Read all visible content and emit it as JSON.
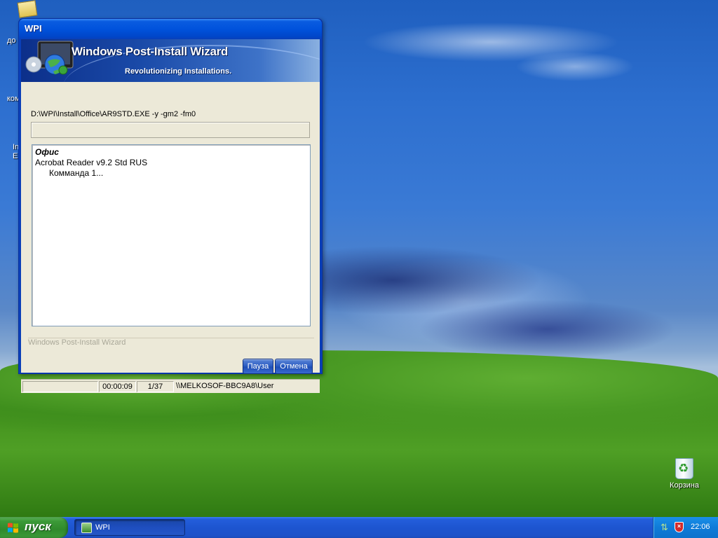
{
  "desktop": {
    "left_icon_labels": [
      "до",
      "ком",
      "In",
      "E"
    ],
    "recycle_bin_label": "Корзина"
  },
  "window": {
    "title": "WPI",
    "banner_title": "Windows Post-Install Wizard",
    "banner_subtitle": "Revolutionizing Installations.",
    "command_line": "D:\\WPI\\Install\\Office\\AR9STD.EXE -y -gm2 -fm0",
    "progress_fraction": 0,
    "log": {
      "category": "Офис",
      "program": "Acrobat Reader v9.2 Std RUS",
      "command": "Комманда 1..."
    },
    "group_label": "Windows Post-Install Wizard",
    "buttons": {
      "pause": "Пауза",
      "cancel": "Отмена"
    },
    "status": {
      "elapsed": "00:00:09",
      "count": "1/37",
      "user": "\\\\MELKOSOF-BBC9A8\\User"
    }
  },
  "taskbar": {
    "start_label": "пуск",
    "tasks": [
      {
        "label": "WPI"
      }
    ],
    "clock": "22:06"
  },
  "colors": {
    "xp_blue": "#0052dc",
    "start_green": "#3c9a38",
    "window_face": "#ece9d8"
  }
}
